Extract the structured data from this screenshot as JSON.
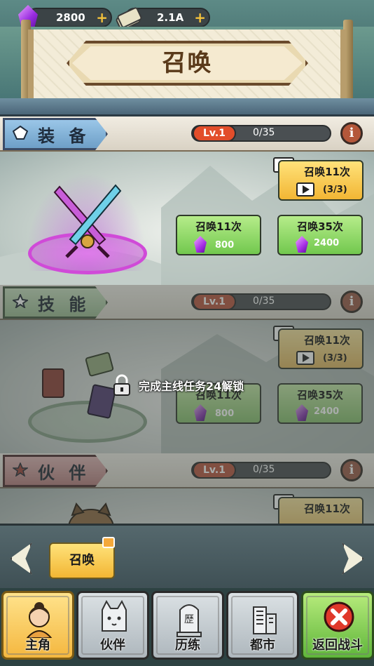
{
  "currency": {
    "gems": "2800",
    "cash": "2.1A",
    "plus": "+"
  },
  "title": "召唤",
  "sections": [
    {
      "name": "装 备",
      "level": "Lv.1",
      "progress": "0/35",
      "info": "i",
      "ad_button": {
        "label": "召唤11次",
        "count": "(3/3)"
      },
      "summon11": {
        "label": "召唤11次",
        "cost": "800"
      },
      "summon35": {
        "label": "召唤35次",
        "cost": "2400"
      }
    },
    {
      "name": "技 能",
      "level": "Lv.1",
      "progress": "0/35",
      "info": "i",
      "ad_button": {
        "label": "召唤11次",
        "count": "(3/3)"
      },
      "summon11": {
        "label": "召唤11次",
        "cost": "800"
      },
      "summon35": {
        "label": "召唤35次",
        "cost": "2400"
      },
      "lock_text": "完成主线任务24解锁"
    },
    {
      "name": "伙 伴",
      "level": "Lv.1",
      "progress": "0/35",
      "info": "i",
      "ad_button": {
        "label": "召唤11次"
      }
    }
  ],
  "carousel": {
    "tab_label": "召唤"
  },
  "nav": {
    "items": [
      "主角",
      "伙伴",
      "历练",
      "都市",
      "返回战斗"
    ],
    "trial_glyph": "歷"
  },
  "colors": {
    "accent_yellow": "#f2b634",
    "accent_green": "#72c84e",
    "level_red": "#e24d2a",
    "gem_purple": "#9a2de0"
  }
}
